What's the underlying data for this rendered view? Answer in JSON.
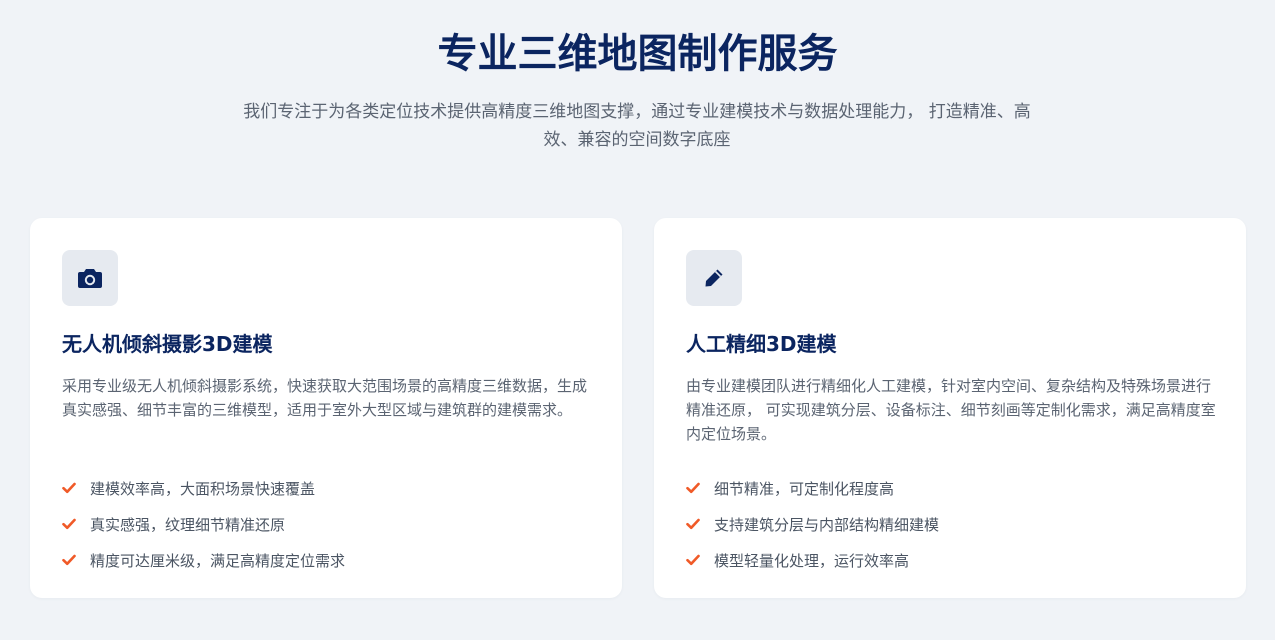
{
  "hero": {
    "title": "专业三维地图制作服务",
    "subtitle": "我们专注于为各类定位技术提供高精度三维地图支撑，通过专业建模技术与数据处理能力， 打造精准、高效、兼容的空间数字底座"
  },
  "cards": [
    {
      "icon": "camera-icon",
      "title": "无人机倾斜摄影3D建模",
      "description": "采用专业级无人机倾斜摄影系统，快速获取大范围场景的高精度三维数据，生成真实感强、细节丰富的三维模型，适用于室外大型区域与建筑群的建模需求。",
      "features": [
        "建模效率高，大面积场景快速覆盖",
        "真实感强，纹理细节精准还原",
        "精度可达厘米级，满足高精度定位需求"
      ]
    },
    {
      "icon": "pencil-icon",
      "title": "人工精细3D建模",
      "description": "由专业建模团队进行精细化人工建模，针对室内空间、复杂结构及特殊场景进行精准还原， 可实现建筑分层、设备标注、细节刻画等定制化需求，满足高精度室内定位场景。",
      "features": [
        "细节精准，可定制化程度高",
        "支持建筑分层与内部结构精细建模",
        "模型轻量化处理，运行效率高"
      ]
    }
  ],
  "colors": {
    "background": "#f0f3f7",
    "heading": "#0b2560",
    "body_text": "#5b6472",
    "icon_bg": "#e6eaf0",
    "check": "#f05a28"
  }
}
